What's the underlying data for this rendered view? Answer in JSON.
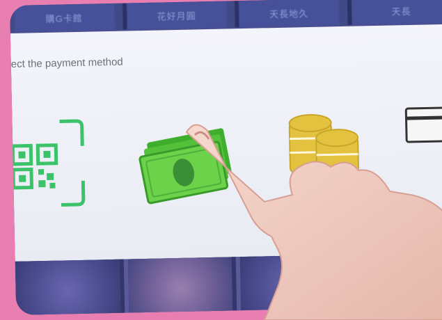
{
  "tabs": [
    {
      "label": "購G卡館"
    },
    {
      "label": "花好月圓"
    },
    {
      "label": "天長地久"
    },
    {
      "label": "天長"
    }
  ],
  "prompt": "ect the payment method",
  "payment_methods": [
    {
      "icon": "qr-code-icon"
    },
    {
      "icon": "cash-icon"
    },
    {
      "icon": "coins-icon"
    },
    {
      "icon": "card-icon"
    }
  ],
  "colors": {
    "background": "#e97fb0",
    "panel": "#f4f5fb",
    "tabbar": "#3f4a86",
    "qr_green": "#3cc36a",
    "cash_green": "#6bd24a",
    "coin_gold": "#e2c23f"
  }
}
